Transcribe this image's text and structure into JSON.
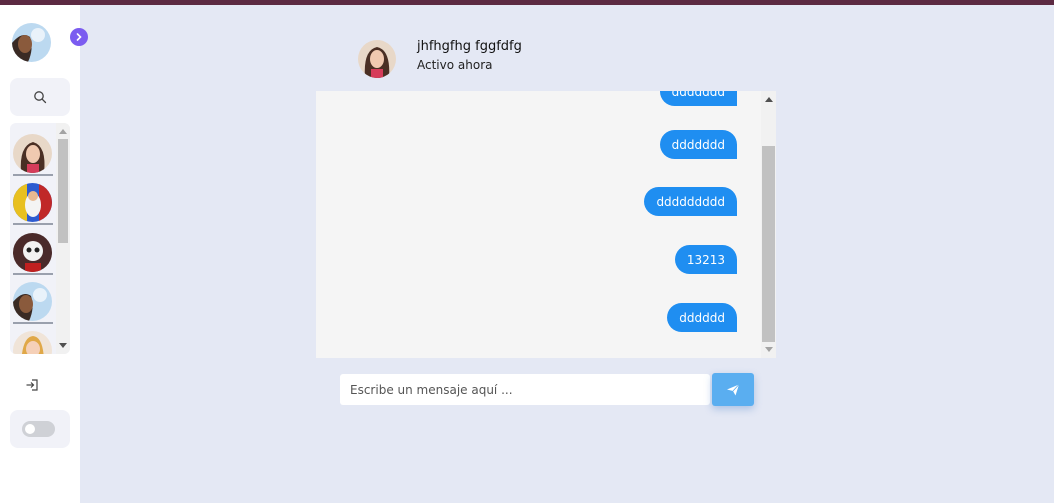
{
  "sidebar": {
    "expand_icon": "chevron-right-icon",
    "search_icon": "search-icon",
    "contacts": [
      {
        "name": "contact-1"
      },
      {
        "name": "contact-2"
      },
      {
        "name": "contact-3"
      },
      {
        "name": "contact-4"
      },
      {
        "name": "contact-5"
      }
    ],
    "logout_icon": "logout-icon",
    "theme_toggle": {
      "on": false
    }
  },
  "chat": {
    "contact_name": "jhfhgfhg fggfdfg",
    "status": "Activo ahora",
    "messages": [
      {
        "text": "ddddddd",
        "from": "me"
      },
      {
        "text": "ddddddd",
        "from": "me"
      },
      {
        "text": "ddddddddd",
        "from": "me"
      },
      {
        "text": "13213",
        "from": "me"
      },
      {
        "text": "dddddd",
        "from": "me"
      }
    ]
  },
  "composer": {
    "placeholder": "Escribe un mensaje aquí ...",
    "value": "",
    "send_icon": "send-icon"
  },
  "colors": {
    "accent": "#1f8ef1",
    "send_button": "#5aaef0",
    "expand_button": "#7b5cf0",
    "topbar": "#5c2a42",
    "background": "#e4e8f4"
  }
}
